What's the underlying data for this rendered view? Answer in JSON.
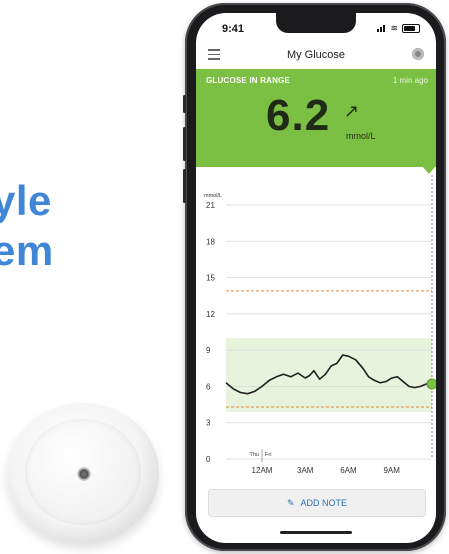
{
  "background": {
    "line1": "yle",
    "line2": "em"
  },
  "status_bar": {
    "time": "9:41"
  },
  "app": {
    "title": "My Glucose",
    "menu_icon": "hamburger-menu-icon",
    "sensor_icon": "sensor-status-icon"
  },
  "glucose": {
    "label": "GLUCOSE IN RANGE",
    "updated": "1 min ago",
    "value": "6.2",
    "unit": "mmol/L",
    "trend_arrow": "↗",
    "panel_color": "#7cc043"
  },
  "chart_data": {
    "type": "line",
    "ylabel": "mmol/L",
    "ylim": [
      0,
      21
    ],
    "yticks": [
      "21",
      "18",
      "15",
      "12",
      "9",
      "6",
      "3",
      "0"
    ],
    "ytick_values": [
      21,
      18,
      15,
      12,
      9,
      6,
      3,
      0
    ],
    "xticks": [
      "12AM",
      "3AM",
      "6AM",
      "9AM"
    ],
    "xtick_hours": [
      0,
      3,
      6,
      9
    ],
    "day_labels": [
      "Thu",
      "Fri"
    ],
    "xlim_hours": [
      -2.5,
      11.8
    ],
    "target_range": [
      3.9,
      10.0
    ],
    "high_threshold": 13.9,
    "low_threshold": 4.3,
    "series": [
      {
        "x_hours": [
          -2.5,
          -2.0,
          -1.5,
          -1.0,
          -0.5,
          0.0,
          0.5,
          1.0,
          1.5,
          2.0,
          2.5,
          3.0,
          3.3,
          3.6,
          4.0,
          4.4,
          4.8,
          5.2,
          5.6,
          6.0,
          6.5,
          7.0,
          7.4,
          7.8,
          8.2,
          8.6,
          9.0,
          9.4,
          9.8,
          10.2,
          10.6,
          11.0,
          11.4,
          11.8
        ],
        "values": [
          6.3,
          5.8,
          5.5,
          5.4,
          5.6,
          6.0,
          6.5,
          6.8,
          7.0,
          6.8,
          7.1,
          6.7,
          6.9,
          7.3,
          6.6,
          7.0,
          7.7,
          7.9,
          8.6,
          8.5,
          8.2,
          7.5,
          6.8,
          6.5,
          6.3,
          6.4,
          6.7,
          6.8,
          6.4,
          6.0,
          5.9,
          6.0,
          6.2,
          6.3
        ]
      }
    ],
    "current_point": 6.2,
    "colors": {
      "line": "#1f1f1f",
      "band": "#e7f3dc",
      "threshold": "#e08a2e",
      "current": "#7cc043",
      "grid": "#d6d6d6"
    }
  },
  "actions": {
    "add_note": "ADD NOTE",
    "add_note_icon": "pencil-icon"
  }
}
